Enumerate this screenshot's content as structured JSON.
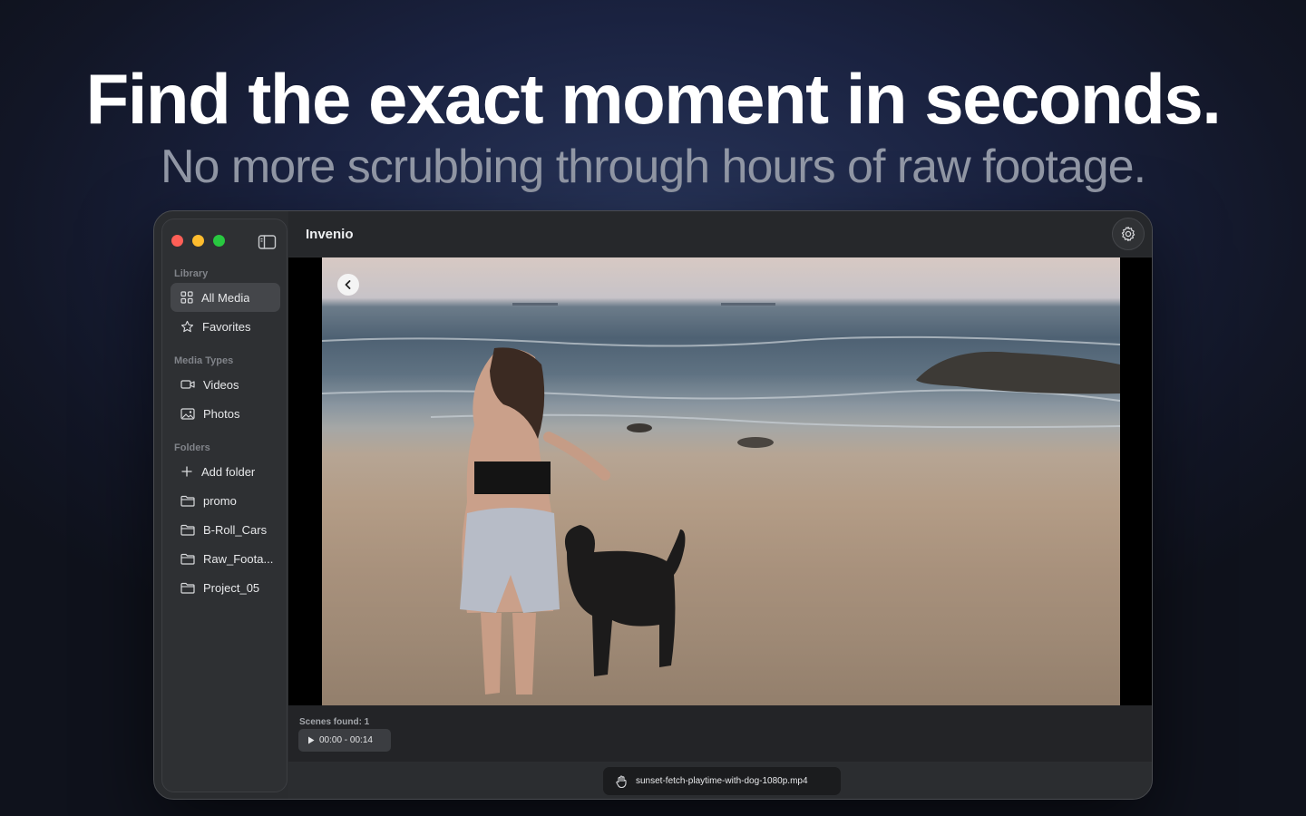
{
  "hero": {
    "headline": "Find the exact moment in seconds.",
    "subline": "No more scrubbing through hours of raw footage."
  },
  "window": {
    "app_title": "Invenio",
    "traffic_lights": [
      "#fe5f57",
      "#febc2e",
      "#28c840"
    ]
  },
  "sidebar": {
    "library_label": "Library",
    "library_items": [
      {
        "label": "All Media",
        "icon": "grid-icon",
        "active": true
      },
      {
        "label": "Favorites",
        "icon": "star-icon",
        "active": false
      }
    ],
    "media_types_label": "Media Types",
    "media_type_items": [
      {
        "label": "Videos",
        "icon": "video-camera-icon"
      },
      {
        "label": "Photos",
        "icon": "photo-icon"
      }
    ],
    "folders_label": "Folders",
    "add_folder_label": "Add folder",
    "folders": [
      {
        "label": "promo"
      },
      {
        "label": "B-Roll_Cars"
      },
      {
        "label": "Raw_Foota..."
      },
      {
        "label": "Project_05"
      }
    ]
  },
  "results": {
    "scenes_found": "Scenes found: 1",
    "scene_range": "00:00 - 00:14"
  },
  "status": {
    "filename": "sunset-fetch-playtime-with-dog-1080p.mp4"
  },
  "colors": {
    "accent_active": "#44464a",
    "window_bg": "#2a2c2f"
  }
}
